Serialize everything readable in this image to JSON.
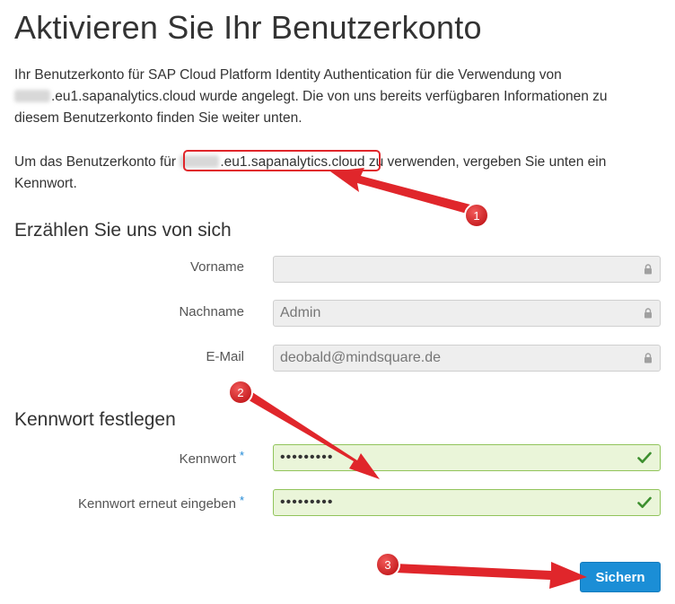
{
  "page": {
    "title": "Aktivieren Sie Ihr Benutzerkonto",
    "intro_line1": "Ihr Benutzerkonto für SAP Cloud Platform Identity Authentication für die Verwendung von",
    "intro_line2_domain": ".eu1.sapanalytics.cloud",
    "intro_line2_rest": " wurde angelegt. Die von uns bereits verfügbaren Informationen zu",
    "intro_line3": "diesem Benutzerkonto finden Sie weiter unten.",
    "use_prefix": "Um das Benutzerkonto für ",
    "use_domain": ".eu1.sapanalytics.cloud",
    "use_suffix": " zu verwenden, vergeben Sie unten ein",
    "use_line2": "Kennwort."
  },
  "about": {
    "heading": "Erzählen Sie uns von sich",
    "firstname_label": "Vorname",
    "firstname_value": "",
    "lastname_label": "Nachname",
    "lastname_value": "Admin",
    "email_label": "E-Mail",
    "email_value": "deobald@mindsquare.de"
  },
  "password": {
    "heading": "Kennwort festlegen",
    "password_label": "Kennwort",
    "password_value": "•••••••••",
    "confirm_label": "Kennwort erneut eingeben",
    "confirm_value": "•••••••••",
    "required_mark": "*"
  },
  "actions": {
    "save_label": "Sichern"
  },
  "annotations": {
    "badge1": "1",
    "badge2": "2",
    "badge3": "3"
  },
  "colors": {
    "accent": "#1b8ed6",
    "valid_bg": "#eaf5d9",
    "valid_border": "#91c45b",
    "annotation_red": "#e0262b"
  },
  "icons": [
    "lock-icon",
    "checkmark-icon",
    "arrow-annotation"
  ]
}
